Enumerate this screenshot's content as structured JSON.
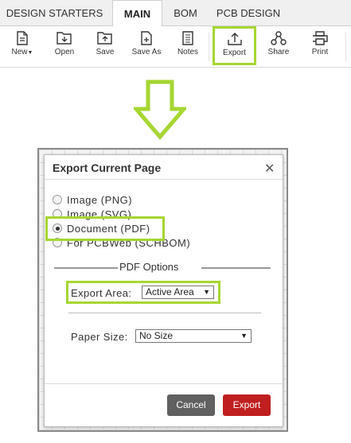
{
  "tabs": [
    {
      "label": "DESIGN STARTERS",
      "active": false
    },
    {
      "label": "MAIN",
      "active": true
    },
    {
      "label": "BOM",
      "active": false
    },
    {
      "label": "PCB DESIGN",
      "active": false
    }
  ],
  "toolbar": {
    "new_label": "New",
    "open_label": "Open",
    "save_label": "Save",
    "save_as_label": "Save As",
    "notes_label": "Notes",
    "export_label": "Export",
    "share_label": "Share",
    "print_label": "Print"
  },
  "highlight_color": "#a6d632",
  "dialog": {
    "title": "Export Current Page",
    "close_glyph": "✕",
    "options": [
      {
        "label": "Image (PNG)",
        "checked": false
      },
      {
        "label": "Image (SVG)",
        "checked": false
      },
      {
        "label": "Document (PDF)",
        "checked": true
      },
      {
        "label": "For PCBWeb (SCHBOM)",
        "checked": false
      }
    ],
    "group_title": "PDF Options",
    "export_area_label": "Export Area:",
    "export_area_value": "Active Area",
    "paper_size_label": "Paper Size:",
    "paper_size_value": "No Size",
    "cancel_label": "Cancel",
    "export_label": "Export",
    "cancel_color": "#606060",
    "export_color": "#c01f1f"
  }
}
